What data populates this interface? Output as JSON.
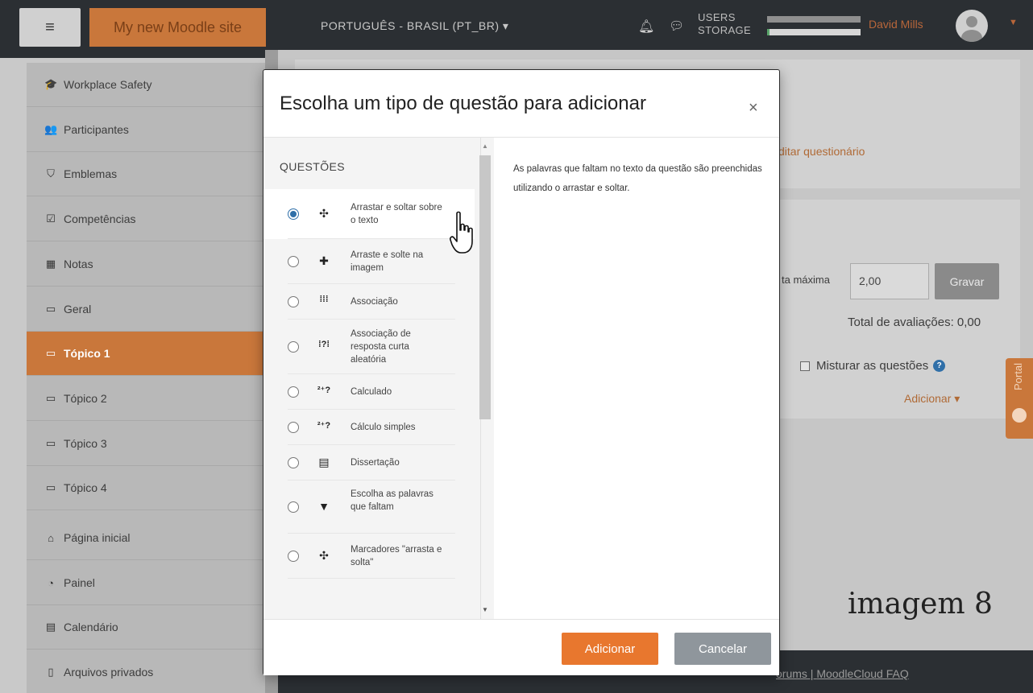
{
  "navbar": {
    "menu_icon": "hamburger-icon",
    "site_name": "My new Moodle site",
    "language": "PORTUGUÊS - BRASIL (PT_BR) ▾",
    "storage_label_line1": "USERS",
    "storage_label_line2": "STORAGE",
    "users_level": 1.0,
    "storage_level": 0.03,
    "user_name": "David Mills"
  },
  "sidebar": {
    "items": [
      {
        "icon": "graduation-cap-icon",
        "glyph": "🎓",
        "label": "Workplace Safety"
      },
      {
        "icon": "users-icon",
        "glyph": "👥",
        "label": "Participantes"
      },
      {
        "icon": "shield-icon",
        "glyph": "⛉",
        "label": "Emblemas"
      },
      {
        "icon": "checkbox-icon",
        "glyph": "☑",
        "label": "Competências"
      },
      {
        "icon": "table-icon",
        "glyph": "▦",
        "label": "Notas"
      },
      {
        "icon": "folder-icon",
        "glyph": "▭",
        "label": "Geral"
      },
      {
        "icon": "folder-icon",
        "glyph": "▭",
        "label": "Tópico 1"
      },
      {
        "icon": "folder-icon",
        "glyph": "▭",
        "label": "Tópico 2"
      },
      {
        "icon": "folder-icon",
        "glyph": "▭",
        "label": "Tópico 3"
      },
      {
        "icon": "folder-icon",
        "glyph": "▭",
        "label": "Tópico 4"
      },
      {
        "icon": "home-icon",
        "glyph": "⌂",
        "label": "Página inicial"
      },
      {
        "icon": "dashboard-icon",
        "glyph": "◔",
        "label": "Painel"
      },
      {
        "icon": "calendar-icon",
        "glyph": "▤",
        "label": "Calendário"
      },
      {
        "icon": "file-icon",
        "glyph": "▯",
        "label": "Arquivos privados"
      }
    ],
    "active_label": "Tópico 1"
  },
  "main": {
    "edit_link": "ditar questionário",
    "max_grade_label": "ta máxima",
    "max_grade_value": "2,00",
    "save_button": "Gravar",
    "total_grades": "Total de avaliações: 0,00",
    "shuffle_label": "Misturar as questões",
    "add_menu": "Adicionar ▾",
    "portal_tab": "Portal",
    "overlay_caption": "imagem 8",
    "footer_links": "orums | ",
    "footer_faq": "MoodleCloud FAQ"
  },
  "modal": {
    "title": "Escolha um tipo de questão para adicionar",
    "close": "×",
    "section_heading": "QUESTÕES",
    "options": [
      {
        "icon": "drag-drop-text-icon",
        "glyph": "✣",
        "label": "Arrastar e soltar sobre o texto",
        "selected": true
      },
      {
        "icon": "drag-drop-image-icon",
        "glyph": "✚",
        "label": "Arraste e solte na imagem",
        "selected": false
      },
      {
        "icon": "matching-icon",
        "glyph": "⁞⁞⁞",
        "label": "Associação",
        "selected": false
      },
      {
        "icon": "random-short-answer-icon",
        "glyph": "⁞?⁞",
        "label": "Associação de resposta curta aleatória",
        "selected": false
      },
      {
        "icon": "calculated-icon",
        "glyph": "²⁺?",
        "label": "Calculado",
        "selected": false
      },
      {
        "icon": "calculated-simple-icon",
        "glyph": "²⁺?",
        "label": "Cálculo simples",
        "selected": false
      },
      {
        "icon": "essay-icon",
        "glyph": "▤",
        "label": "Dissertação",
        "selected": false
      },
      {
        "icon": "dropdown-icon",
        "glyph": "▼",
        "label": "Escolha as palavras que faltam",
        "selected": false
      },
      {
        "icon": "drag-markers-icon",
        "glyph": "✣",
        "label": "Marcadores \"arrasta e solta\"",
        "selected": false
      }
    ],
    "description": "As palavras que faltam no texto da questão são preenchidas utilizando o arrastar e soltar.",
    "add_button": "Adicionar",
    "cancel_button": "Cancelar"
  },
  "colors": {
    "brand": "#c9773b",
    "navbar": "#2b2f33",
    "primary_button": "#e8772e",
    "secondary_button": "#8f969c",
    "radio_selected": "#2f6fa8"
  }
}
